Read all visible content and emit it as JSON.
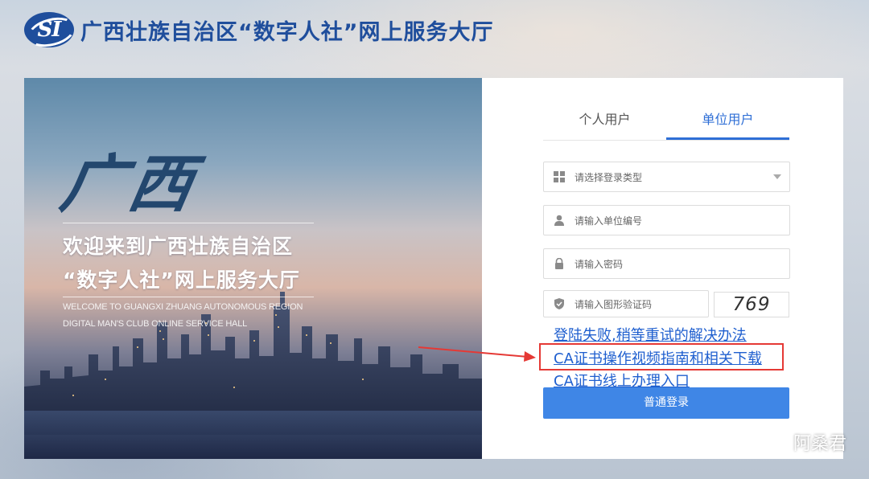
{
  "header": {
    "logo_text": "SI",
    "title": "广西壮族自治区“数字人社”网上服务大厅"
  },
  "hero": {
    "calligraphy": "广西",
    "welcome_line1": "欢迎来到广西壮族自治区",
    "welcome_line2": "“数字人社”网上服务大厅",
    "english_line1": "WELCOME TO GUANGXI ZHUANG AUTONOMOUS REGION",
    "english_line2": "DIGITAL MAN'S CLUB ONLINE SERVICE HALL"
  },
  "login": {
    "tabs": [
      {
        "label": "个人用户",
        "active": false
      },
      {
        "label": "单位用户",
        "active": true
      }
    ],
    "login_type_placeholder": "请选择登录类型",
    "unit_id_placeholder": "请输入单位编号",
    "password_placeholder": "请输入密码",
    "captcha_placeholder": "请输入图形验证码",
    "captcha_code": "769",
    "links": [
      "登陆失败,稍等重试的解决办法",
      "CA证书操作视频指南和相关下载",
      "CA证书线上办理入口"
    ],
    "login_button": "普通登录"
  },
  "watermark": {
    "text": "阿桑君"
  },
  "colors": {
    "brand_blue": "#1f4e9c",
    "tab_active": "#2f6fd6",
    "button": "#3f86e6",
    "link": "#1f5fcf",
    "highlight_red": "#e53935"
  }
}
